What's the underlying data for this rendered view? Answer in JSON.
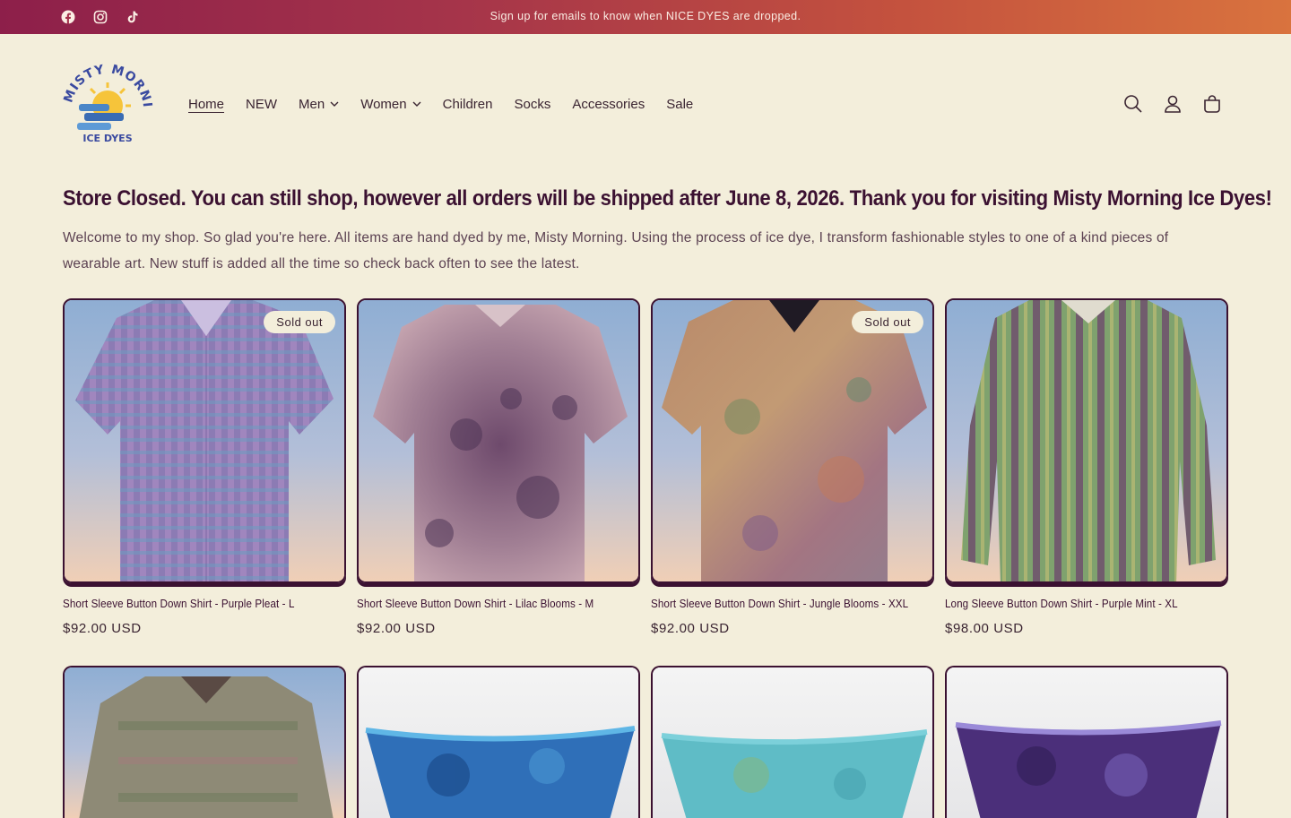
{
  "announcement": {
    "text": "Sign up for emails to know when NICE DYES are dropped.",
    "social": [
      "facebook-icon",
      "instagram-icon",
      "tiktok-icon"
    ]
  },
  "header": {
    "logo_text_top": "MISTY MORNING",
    "logo_text_bottom": "ICE DYES",
    "nav": [
      {
        "label": "Home",
        "active": true,
        "dropdown": false
      },
      {
        "label": "NEW",
        "active": false,
        "dropdown": false
      },
      {
        "label": "Men",
        "active": false,
        "dropdown": true
      },
      {
        "label": "Women",
        "active": false,
        "dropdown": true
      },
      {
        "label": "Children",
        "active": false,
        "dropdown": false
      },
      {
        "label": "Socks",
        "active": false,
        "dropdown": false
      },
      {
        "label": "Accessories",
        "active": false,
        "dropdown": false
      },
      {
        "label": "Sale",
        "active": false,
        "dropdown": false
      }
    ],
    "icons": [
      "search-icon",
      "account-icon",
      "cart-icon"
    ]
  },
  "notice": "Store Closed. You can still shop, however all orders will be shipped after June 8, 2026. Thank you for visiting Misty Morning Ice Dyes!",
  "intro": "Welcome to my shop. So glad you're here. All items are hand dyed by me, Misty Morning. Using the process of ice dye, I transform fashionable styles to one of a kind pieces of wearable art. New stuff is added all the time so check back often to see the latest.",
  "products": [
    {
      "title": "Short Sleeve Button Down Shirt - Purple Pleat - L",
      "price": "$92.00 USD",
      "badge": "Sold out"
    },
    {
      "title": "Short Sleeve Button Down Shirt - Lilac Blooms - M",
      "price": "$92.00 USD",
      "badge": ""
    },
    {
      "title": "Short Sleeve Button Down Shirt - Jungle Blooms - XXL",
      "price": "$92.00 USD",
      "badge": "Sold out"
    },
    {
      "title": "Long Sleeve Button Down Shirt - Purple Mint - XL",
      "price": "$98.00 USD",
      "badge": ""
    }
  ],
  "colors": {
    "brand_dark": "#3b1131",
    "background": "#f3eedb",
    "banner_start": "#8d1f4a",
    "banner_end": "#d9733e"
  }
}
